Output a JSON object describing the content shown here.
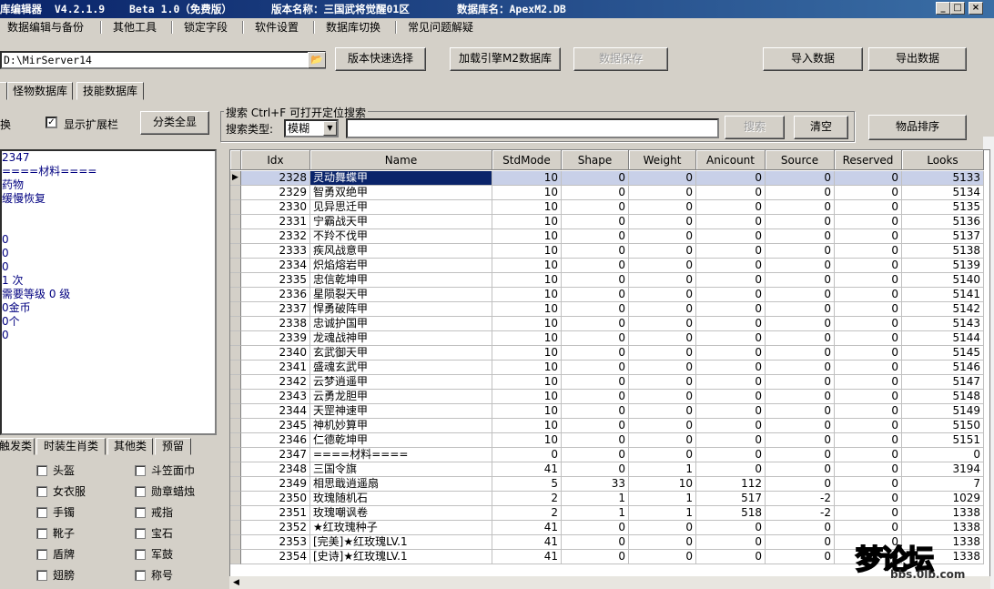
{
  "title": {
    "app": "库编辑器  V4.2.1.9",
    "beta": "Beta 1.0（免费版）",
    "version": "版本名称：三国武将觉醒01区",
    "db": "数据库名：ApexM2.DB",
    "min": "_",
    "max": "□",
    "close": "×"
  },
  "menu": [
    "数据编辑与备份",
    "其他工具",
    "锁定字段",
    "软件设置",
    "数据库切换",
    "常见问题解疑"
  ],
  "toolbar": {
    "path": "D:\\MirServer14",
    "folder_icon": "📂",
    "version_select": "版本快速选择",
    "load_engine": "加载引擎M2数据库",
    "save": "数据保存",
    "import": "导入数据",
    "export": "导出数据"
  },
  "tabs": [
    "怪物数据库",
    "技能数据库"
  ],
  "left": {
    "switch_label": "换",
    "show_ext": "显示扩展栏",
    "show_ext_checked": "✓",
    "classify_all": "分类全显"
  },
  "search": {
    "group_title": "搜索   Ctrl+F 可打开定位搜索",
    "type_label": "搜索类型:",
    "type_value": "模糊",
    "combo_arrow": "▼",
    "search_btn": "搜索",
    "clear_btn": "清空",
    "sort_btn": "物品排序"
  },
  "info_lines": [
    "2347",
    "====材料====",
    "药物",
    "缓慢恢复",
    "",
    "",
    "0",
    "0",
    "0",
    "1 次",
    "需要等级 0 级",
    "0金币",
    "0个",
    "0"
  ],
  "bottom_tabs": [
    "触发类",
    "时装生肖类",
    "其他类",
    "预留"
  ],
  "categories": [
    [
      "头盔",
      "斗笠面巾"
    ],
    [
      "女衣服",
      "勋章蜡烛"
    ],
    [
      "手镯",
      "戒指"
    ],
    [
      "靴子",
      "宝石"
    ],
    [
      "盾牌",
      "军鼓"
    ],
    [
      "翅膀",
      "称号"
    ]
  ],
  "grid": {
    "columns": [
      "Idx",
      "Name",
      "StdMode",
      "Shape",
      "Weight",
      "Anicount",
      "Source",
      "Reserved",
      "Looks"
    ],
    "current_row_marker": "▶",
    "rows": [
      [
        "2328",
        "灵动舞蝶甲",
        "10",
        "0",
        "0",
        "0",
        "0",
        "0",
        "5133"
      ],
      [
        "2329",
        "智勇双绝甲",
        "10",
        "0",
        "0",
        "0",
        "0",
        "0",
        "5134"
      ],
      [
        "2330",
        "见异思迁甲",
        "10",
        "0",
        "0",
        "0",
        "0",
        "0",
        "5135"
      ],
      [
        "2331",
        "宁霸战天甲",
        "10",
        "0",
        "0",
        "0",
        "0",
        "0",
        "5136"
      ],
      [
        "2332",
        "不羚不伐甲",
        "10",
        "0",
        "0",
        "0",
        "0",
        "0",
        "5137"
      ],
      [
        "2333",
        "疾风战意甲",
        "10",
        "0",
        "0",
        "0",
        "0",
        "0",
        "5138"
      ],
      [
        "2334",
        "炽焰熔岩甲",
        "10",
        "0",
        "0",
        "0",
        "0",
        "0",
        "5139"
      ],
      [
        "2335",
        "忠信乾坤甲",
        "10",
        "0",
        "0",
        "0",
        "0",
        "0",
        "5140"
      ],
      [
        "2336",
        "星陨裂天甲",
        "10",
        "0",
        "0",
        "0",
        "0",
        "0",
        "5141"
      ],
      [
        "2337",
        "悍勇破阵甲",
        "10",
        "0",
        "0",
        "0",
        "0",
        "0",
        "5142"
      ],
      [
        "2338",
        "忠诚护国甲",
        "10",
        "0",
        "0",
        "0",
        "0",
        "0",
        "5143"
      ],
      [
        "2339",
        "龙魂战神甲",
        "10",
        "0",
        "0",
        "0",
        "0",
        "0",
        "5144"
      ],
      [
        "2340",
        "玄武御天甲",
        "10",
        "0",
        "0",
        "0",
        "0",
        "0",
        "5145"
      ],
      [
        "2341",
        "盛魂玄武甲",
        "10",
        "0",
        "0",
        "0",
        "0",
        "0",
        "5146"
      ],
      [
        "2342",
        "云梦逍遥甲",
        "10",
        "0",
        "0",
        "0",
        "0",
        "0",
        "5147"
      ],
      [
        "2343",
        "云勇龙胆甲",
        "10",
        "0",
        "0",
        "0",
        "0",
        "0",
        "5148"
      ],
      [
        "2344",
        "天罡神速甲",
        "10",
        "0",
        "0",
        "0",
        "0",
        "0",
        "5149"
      ],
      [
        "2345",
        "神机妙算甲",
        "10",
        "0",
        "0",
        "0",
        "0",
        "0",
        "5150"
      ],
      [
        "2346",
        "仁德乾坤甲",
        "10",
        "0",
        "0",
        "0",
        "0",
        "0",
        "5151"
      ],
      [
        "2347",
        "====材料====",
        "0",
        "0",
        "0",
        "0",
        "0",
        "0",
        "0"
      ],
      [
        "2348",
        "三国令旗",
        "41",
        "0",
        "1",
        "0",
        "0",
        "0",
        "3194"
      ],
      [
        "2349",
        "相思戢逍遥扇",
        "5",
        "33",
        "10",
        "112",
        "0",
        "0",
        "7"
      ],
      [
        "2350",
        "玫瑰随机石",
        "2",
        "1",
        "1",
        "517",
        "-2",
        "0",
        "1029"
      ],
      [
        "2351",
        "玫瑰嘲讽卷",
        "2",
        "1",
        "1",
        "518",
        "-2",
        "0",
        "1338"
      ],
      [
        "2352",
        "★红玫瑰种子",
        "41",
        "0",
        "0",
        "0",
        "0",
        "0",
        "1338"
      ],
      [
        "2353",
        "[完美]★红玫瑰LV.1",
        "41",
        "0",
        "0",
        "0",
        "0",
        "0",
        "1338"
      ],
      [
        "2354",
        "[史诗]★红玫瑰LV.1",
        "41",
        "0",
        "0",
        "0",
        "0",
        "0",
        "1338"
      ]
    ]
  },
  "scroll": {
    "left_arrow": "◀"
  },
  "watermark": {
    "logo": "梦论坛",
    "url": "bbs.0lb.com"
  }
}
